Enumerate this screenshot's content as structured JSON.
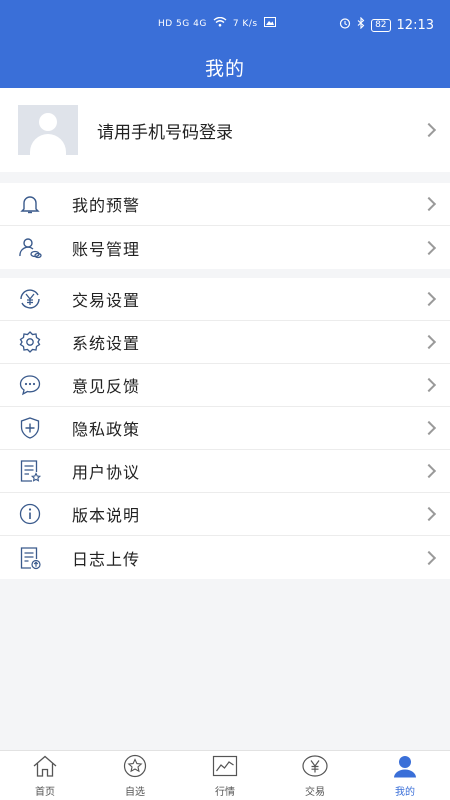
{
  "status": {
    "network": "HD 5G 4G",
    "speed": "7 K/s",
    "battery": "82",
    "time": "12:13"
  },
  "header": {
    "title": "我的"
  },
  "profile": {
    "login_prompt": "请用手机号码登录"
  },
  "group1": [
    {
      "label": "我的预警",
      "icon": "bell-icon"
    },
    {
      "label": "账号管理",
      "icon": "user-link-icon"
    }
  ],
  "group2": [
    {
      "label": "交易设置",
      "icon": "yen-refresh-icon"
    },
    {
      "label": "系统设置",
      "icon": "gear-icon"
    },
    {
      "label": "意见反馈",
      "icon": "chat-bubble-icon"
    },
    {
      "label": "隐私政策",
      "icon": "shield-plus-icon"
    },
    {
      "label": "用户协议",
      "icon": "document-star-icon"
    },
    {
      "label": "版本说明",
      "icon": "info-icon"
    },
    {
      "label": "日志上传",
      "icon": "document-upload-icon"
    }
  ],
  "tabbar": [
    {
      "label": "首页",
      "icon": "home-icon"
    },
    {
      "label": "自选",
      "icon": "star-icon"
    },
    {
      "label": "行情",
      "icon": "chart-icon"
    },
    {
      "label": "交易",
      "icon": "yen-icon"
    },
    {
      "label": "我的",
      "icon": "person-icon",
      "active": true
    }
  ],
  "colors": {
    "primary": "#3a6fd8",
    "icon": "#3a5a8c",
    "background": "#f4f5f7"
  }
}
